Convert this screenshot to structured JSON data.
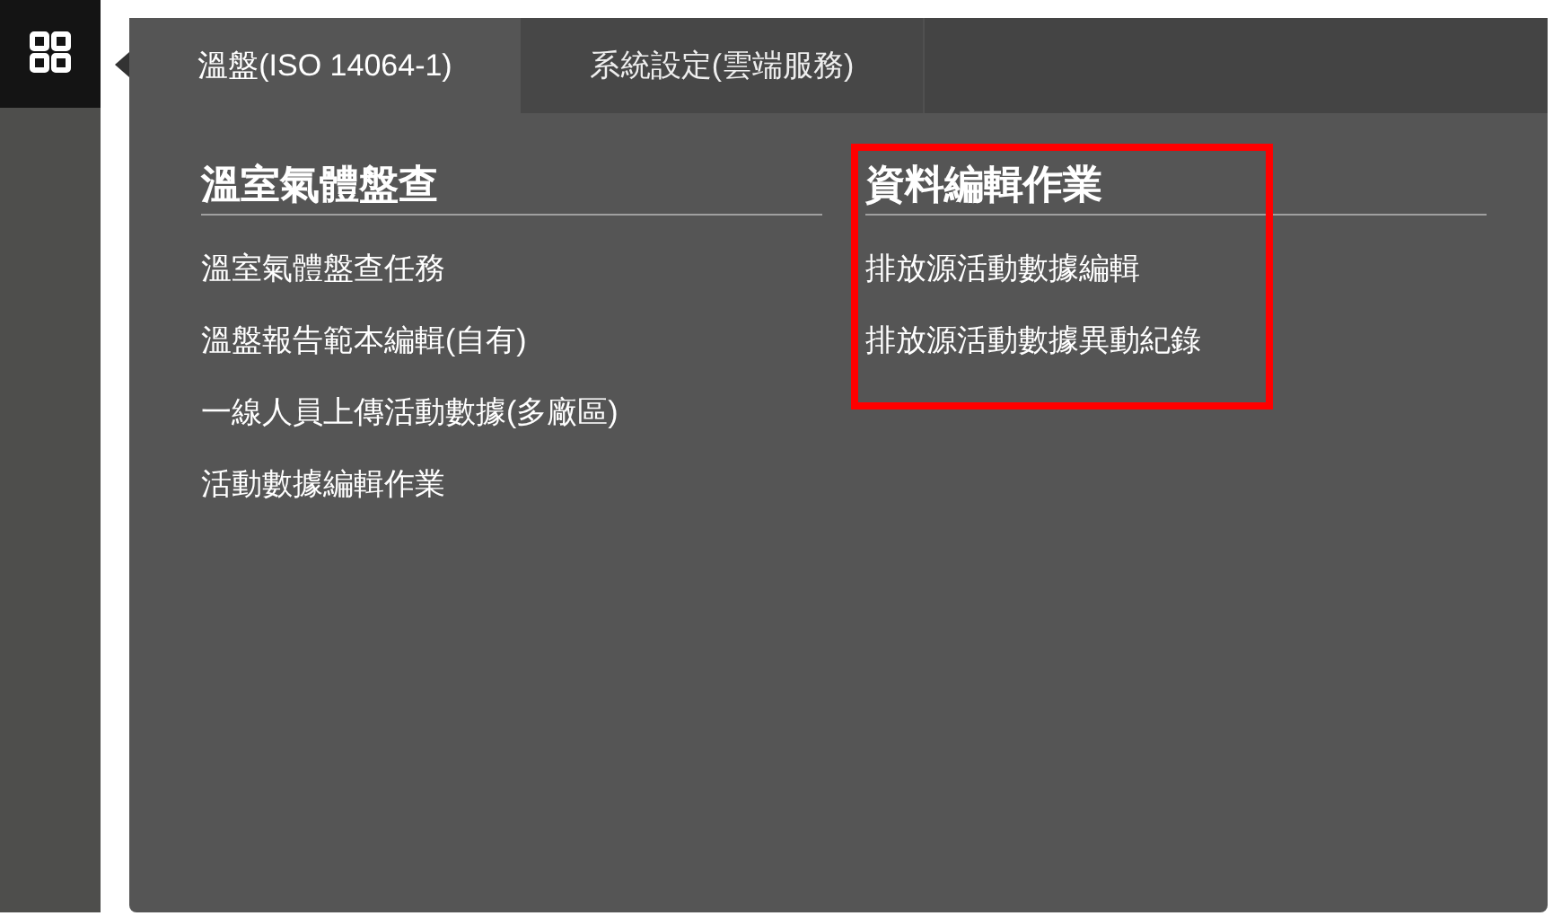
{
  "tabs": [
    {
      "label": "溫盤(ISO 14064-1)",
      "selected": true
    },
    {
      "label": "系統設定(雲端服務)",
      "selected": false
    }
  ],
  "sections": [
    {
      "title": "溫室氣體盤查",
      "highlighted": false,
      "items": [
        "溫室氣體盤查任務",
        "溫盤報告範本編輯(自有)",
        "一線人員上傳活動數據(多廠區)",
        "活動數據編輯作業"
      ]
    },
    {
      "title": "資料編輯作業",
      "highlighted": true,
      "items": [
        "排放源活動數據編輯",
        "排放源活動數據異動紀錄"
      ]
    }
  ]
}
